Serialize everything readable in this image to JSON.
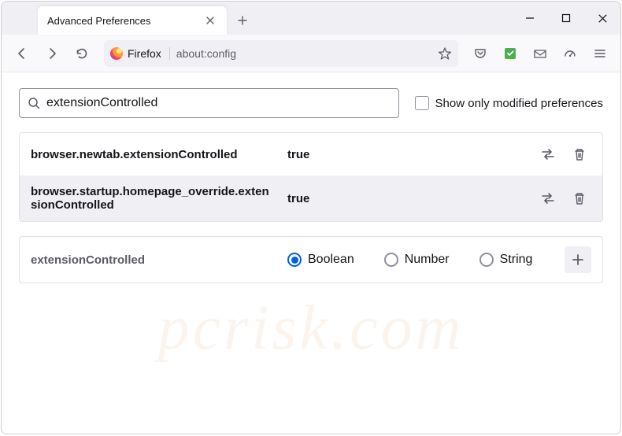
{
  "window": {
    "tab_title": "Advanced Preferences"
  },
  "urlbar": {
    "identity_label": "Firefox",
    "url": "about:config"
  },
  "search": {
    "value": "extensionControlled",
    "modified_label": "Show only modified preferences"
  },
  "prefs": [
    {
      "name": "browser.newtab.extensionControlled",
      "value": "true"
    },
    {
      "name": "browser.startup.homepage_override.extensionControlled",
      "value": "true"
    }
  ],
  "newpref": {
    "name": "extensionControlled",
    "types": [
      "Boolean",
      "Number",
      "String"
    ],
    "selected": 0
  },
  "watermark": "pcrisk.com"
}
